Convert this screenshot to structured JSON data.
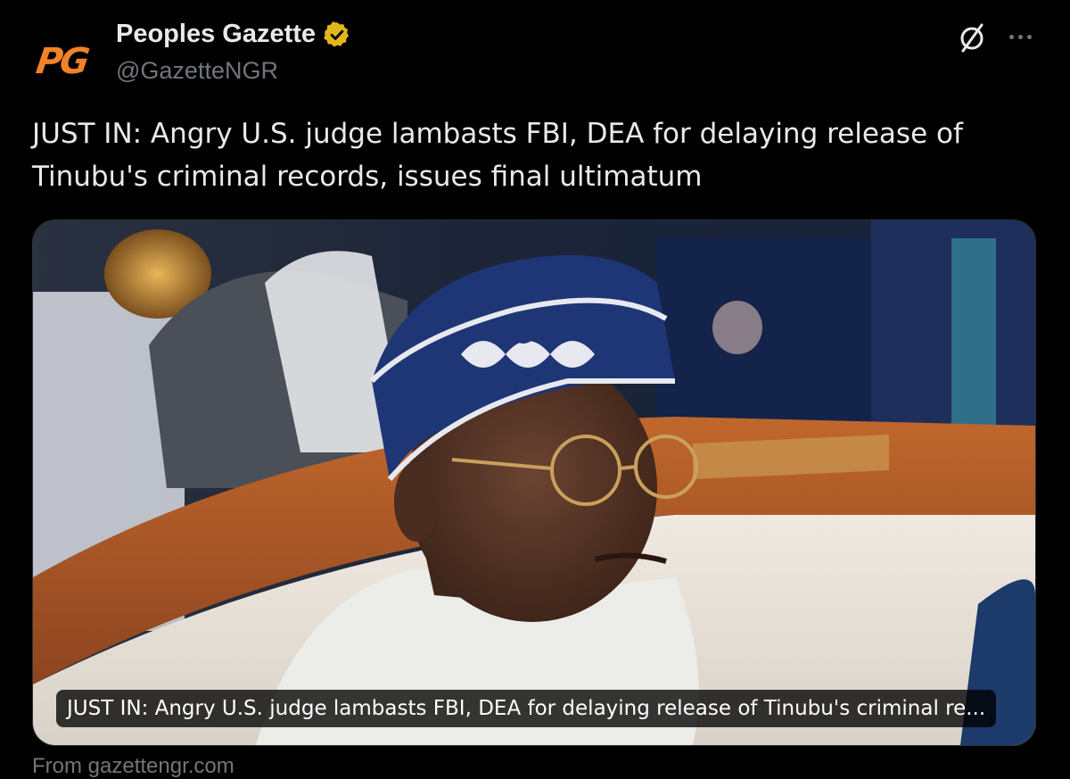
{
  "author": {
    "avatar_text": "PG",
    "display_name": "Peoples Gazette",
    "handle": "@GazetteNGR",
    "verified": true
  },
  "tweet": {
    "text": "JUST IN: Angry U.S. judge lambasts FBI, DEA for delaying release of Tinubu's criminal records, issues final ultimatum"
  },
  "link_card": {
    "caption": "JUST IN: Angry U.S. judge lambasts FBI, DEA for delaying release of Tinubu's criminal re...",
    "source": "From gazettengr.com"
  },
  "icons": {
    "grok": "grok-icon",
    "more": "more-options-icon",
    "verified": "verified-badge-icon"
  },
  "colors": {
    "background": "#000000",
    "text_primary": "#e7e9ea",
    "text_secondary": "#71767b",
    "verified_gold": "#e2b719",
    "avatar_brand": "#f0832a"
  }
}
